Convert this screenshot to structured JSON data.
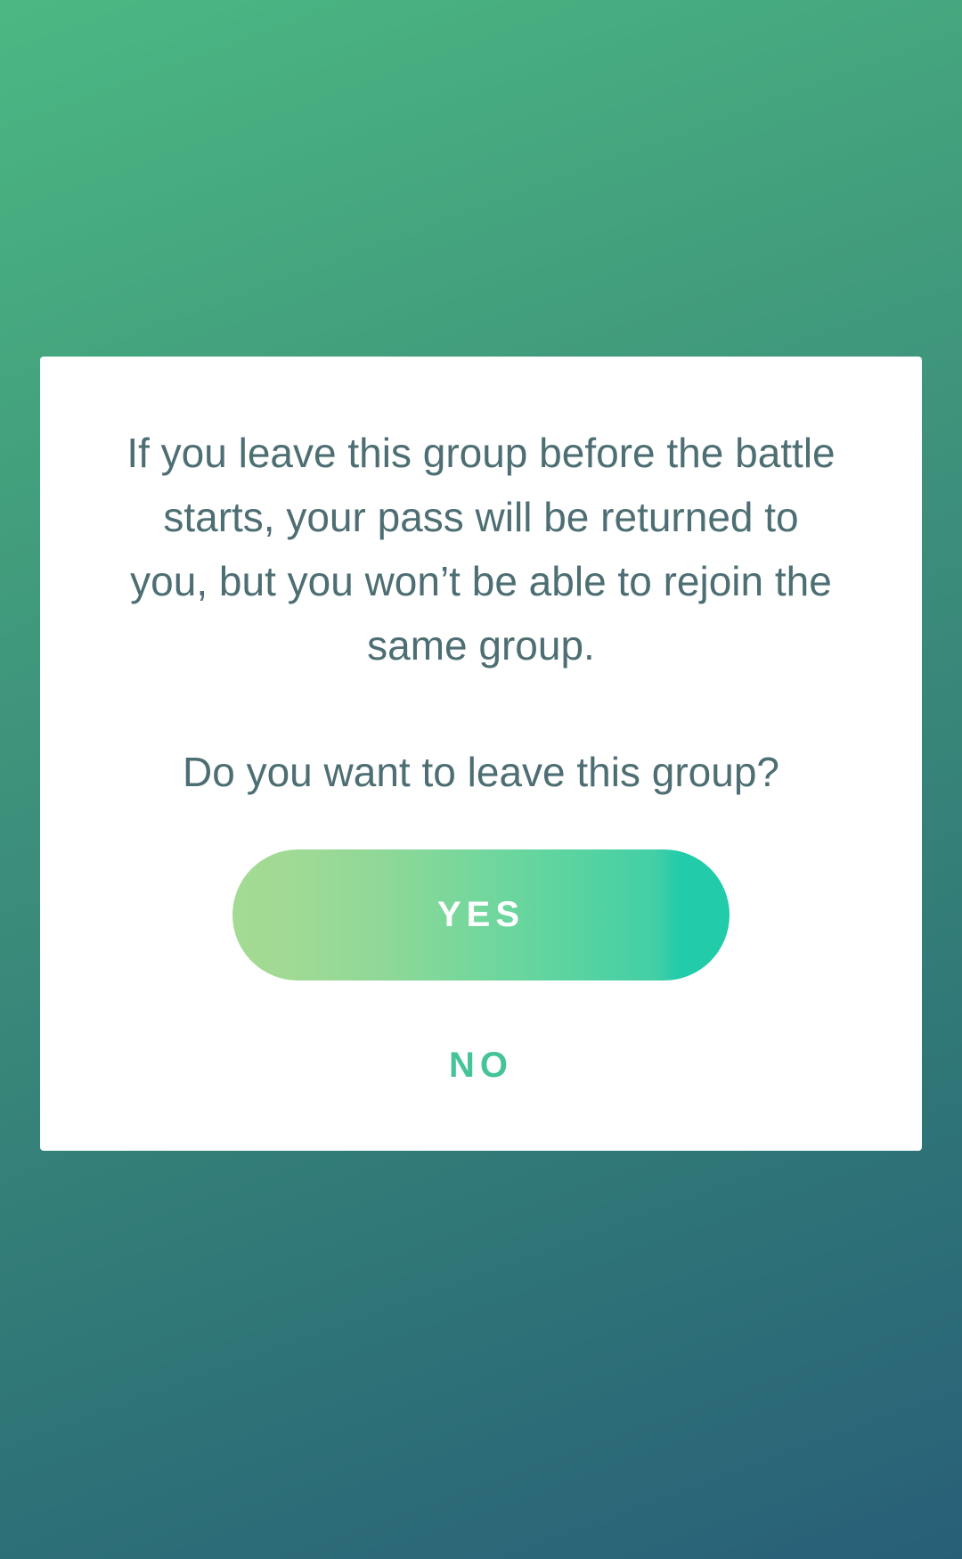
{
  "dialog": {
    "message": "If you leave this group before the battle starts, your pass will be returned to you, but you won’t be able to rejoin the same group.",
    "question": "Do you want to leave this group?",
    "yes_label": "YES",
    "no_label": "NO"
  },
  "colors": {
    "text": "#4d6e72",
    "accent": "#45c399",
    "button_gradient_start": "#a4db94",
    "button_gradient_end": "#22cbaa"
  }
}
